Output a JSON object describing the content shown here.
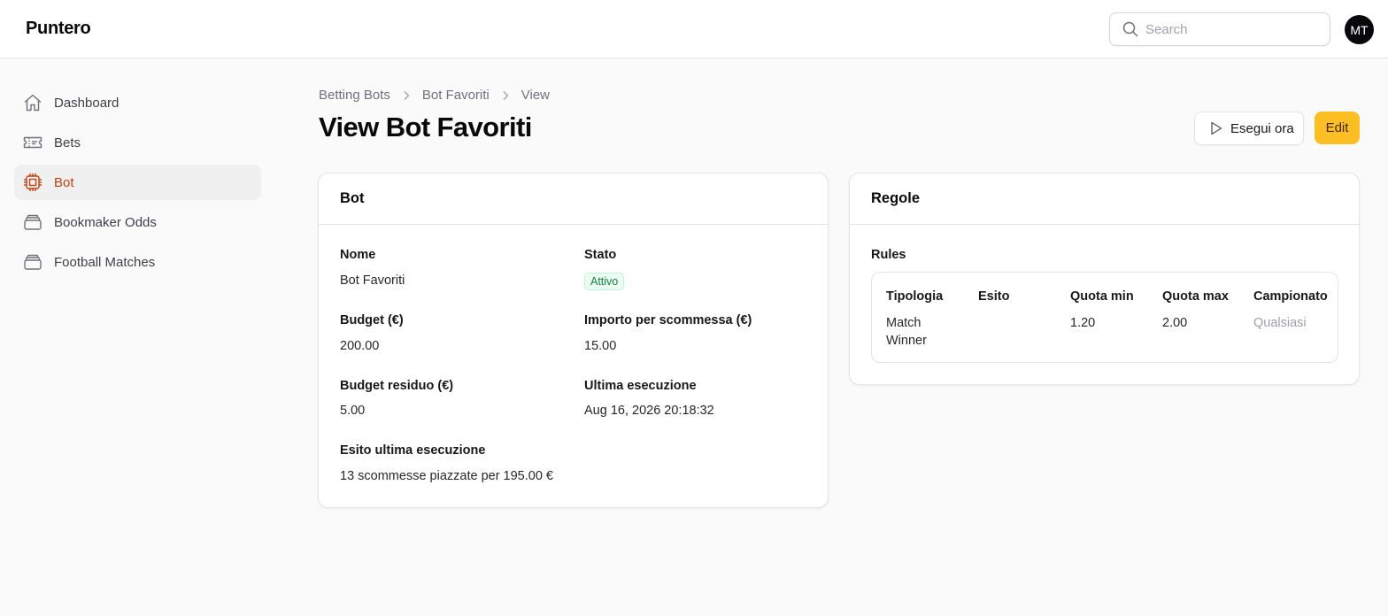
{
  "app": {
    "title": "Puntero"
  },
  "header": {
    "search_placeholder": "Search",
    "avatar_initials": "MT"
  },
  "sidebar": {
    "items": [
      {
        "label": "Dashboard",
        "icon": "home-icon",
        "active": false
      },
      {
        "label": "Bets",
        "icon": "ticket-icon",
        "active": false
      },
      {
        "label": "Bot",
        "icon": "cpu-chip-icon",
        "active": true
      },
      {
        "label": "Bookmaker Odds",
        "icon": "stack-icon",
        "active": false
      },
      {
        "label": "Football Matches",
        "icon": "stack-icon",
        "active": false
      }
    ]
  },
  "breadcrumb": [
    "Betting Bots",
    "Bot Favoriti",
    "View"
  ],
  "page": {
    "title": "View Bot Favoriti",
    "run_button": "Esegui ora",
    "edit_button": "Edit"
  },
  "bot_card": {
    "title": "Bot",
    "fields": {
      "nome_label": "Nome",
      "nome_value": "Bot Favoriti",
      "stato_label": "Stato",
      "stato_value": "Attivo",
      "budget_label": "Budget (€)",
      "budget_value": "200.00",
      "importo_label": "Importo per scommessa (€)",
      "importo_value": "15.00",
      "residuo_label": "Budget residuo (€)",
      "residuo_value": "5.00",
      "ultima_label": "Ultima esecuzione",
      "ultima_value": "Aug 16, 2026 20:18:32",
      "esito_label": "Esito ultima esecuzione",
      "esito_value": "13 scommesse piazzate per 195.00 €"
    }
  },
  "rules_card": {
    "title": "Regole",
    "section_label": "Rules",
    "columns": [
      "Tipologia",
      "Esito",
      "Quota min",
      "Quota max",
      "Campionato"
    ],
    "rows": [
      {
        "tipologia": "Match Winner",
        "esito": "",
        "quota_min": "1.20",
        "quota_max": "2.00",
        "campionato": "Qualsiasi"
      }
    ]
  },
  "colors": {
    "accent": "#c2410c",
    "edit_button": "#fbbf24",
    "status_active": "#15803d"
  }
}
